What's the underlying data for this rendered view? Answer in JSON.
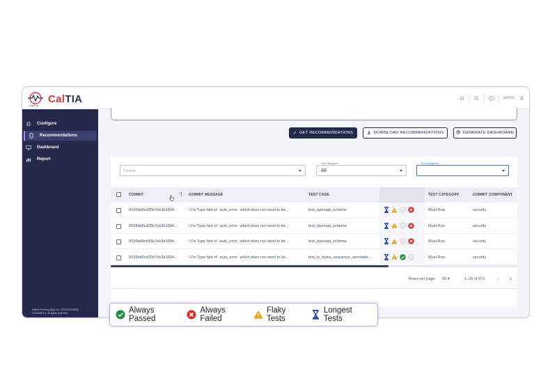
{
  "brand": {
    "logo_subtext": "CalTIA",
    "name_part1": "Cal",
    "name_part2": "TIA"
  },
  "topbar": {
    "user": "admin",
    "icons": [
      "bell-icon",
      "search-icon",
      "help-icon",
      "user-icon"
    ]
  },
  "sidebar": {
    "items": [
      {
        "label": "Configure",
        "icon": "gear-icon",
        "active": false
      },
      {
        "label": "Recommendations",
        "icon": "phone-icon",
        "active": true
      },
      {
        "label": "Dashboard",
        "icon": "monitor-icon",
        "active": false
      },
      {
        "label": "Report",
        "icon": "chart-icon",
        "active": false
      }
    ],
    "patent_line1": "Patent Pending (App No.: 202421044855)",
    "patent_line2": "©CalSoft,Inc. All rights reserved."
  },
  "toolbar": {
    "get_label": "GET RECOMMENDATIONS",
    "download_label": "DOWNLOAD RECOMMENDATIONS",
    "generate_label": "GENERATE DASHBOARD"
  },
  "filters": {
    "commit_placeholder": "Commit",
    "test_categories_label": "Test Categories",
    "test_categories_value": "All",
    "run_categories_label": "Run Categories",
    "run_categories_value": ""
  },
  "table": {
    "headers": {
      "commit": "COMMIT",
      "message": "COMMIT MESSAGE",
      "test_case": "TEST CASE",
      "category": "TEST CATEGORY",
      "component": "COMMIT COMPONENT"
    },
    "rows": [
      {
        "commit": "0539dd9cd35b7eb3b1994...",
        "message": "\\ Fix Type hint of `auto_error` which does not need to be...",
        "test_case": "test_openapi_schema",
        "category": "Must Run",
        "component": "security",
        "statuses": [
          "longest",
          "flaky",
          "neutral",
          "failed"
        ]
      },
      {
        "commit": "0539dd9cd35b7eb3b1994...",
        "message": "\\ Fix Type hint of `auto_error` which does not need to be...",
        "test_case": "test_openapi_schema",
        "category": "Must Run",
        "component": "security",
        "statuses": [
          "longest",
          "flaky",
          "neutral",
          "failed"
        ]
      },
      {
        "commit": "0539dd9cd35b7eb3b1994...",
        "message": "\\ Fix Type hint of `auto_error` which does not need to be...",
        "test_case": "test_openapi_schema",
        "category": "Must Run",
        "component": "security",
        "statuses": [
          "longest",
          "flaky",
          "neutral",
          "failed"
        ]
      },
      {
        "commit": "0539dd9cd35b7eb3b1994...",
        "message": "\\ Fix Type hint of `auto_error` which does not need to be...",
        "test_case": "test_is_bytes_sequence_annotatio...",
        "category": "Must Run",
        "component": "security",
        "statuses": [
          "longest",
          "flaky",
          "passed",
          "neutral"
        ]
      }
    ],
    "footer": {
      "rows_per_page_label": "Rows per page:",
      "rows_per_page": "25",
      "range": "1–25 of 371"
    }
  },
  "legend": {
    "passed": "Always Passed",
    "failed": "Always Failed",
    "flaky": "Flaky Tests",
    "longest": "Longest Tests"
  },
  "colors": {
    "navy": "#25284b",
    "passed": "#1e8e3e",
    "failed": "#d93025",
    "flaky": "#f29900",
    "longest": "#1a3fa6",
    "brand_red": "#d9363e"
  }
}
